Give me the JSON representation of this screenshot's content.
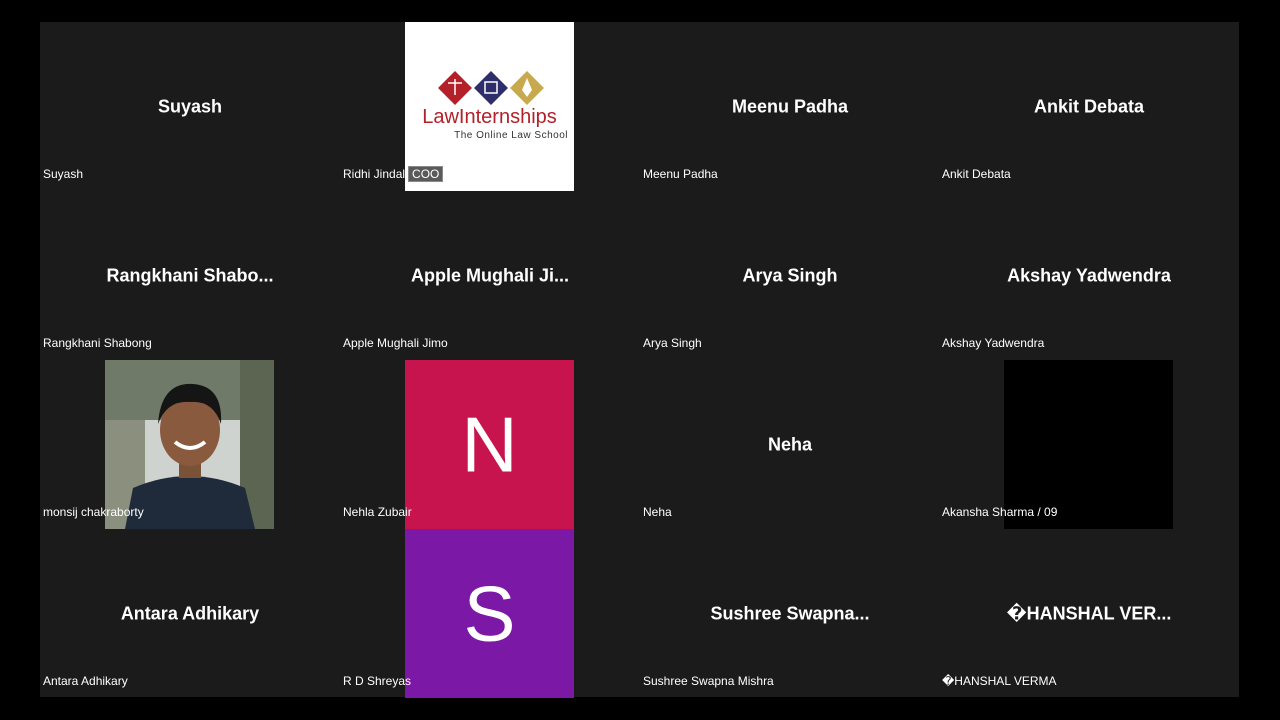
{
  "participants": [
    {
      "display": "Suyash",
      "label": "Suyash"
    },
    {
      "display": "",
      "label": "Ridhi Jindal",
      "role": "COO",
      "logo": {
        "title": "LawInternships",
        "subtitle": "The Online Law School"
      }
    },
    {
      "display": "Meenu Padha",
      "label": "Meenu Padha"
    },
    {
      "display": "Ankit Debata",
      "label": "Ankit Debata"
    },
    {
      "display": "Rangkhani  Shabo...",
      "label": "Rangkhani Shabong"
    },
    {
      "display": "Apple  Mughali  Ji...",
      "label": "Apple Mughali Jimo"
    },
    {
      "display": "Arya Singh",
      "label": "Arya Singh"
    },
    {
      "display": "Akshay Yadwendra",
      "label": "Akshay Yadwendra"
    },
    {
      "display": "",
      "label": "monsij chakraborty"
    },
    {
      "display": "",
      "label": "Nehla Zubair",
      "avatar_letter": "N",
      "avatar_color": "#c8144e"
    },
    {
      "display": "Neha",
      "label": "Neha"
    },
    {
      "display": "",
      "label": "Akansha Sharma / 09"
    },
    {
      "display": "Antara Adhikary",
      "label": "Antara Adhikary"
    },
    {
      "display": "",
      "label": "R D Shreyas",
      "avatar_letter": "S",
      "avatar_color": "#7b18a6"
    },
    {
      "display": "Sushree  Swapna...",
      "label": "Sushree Swapna Mishra"
    },
    {
      "display": "�HANSHAL  VER...",
      "label": "�HANSHAL VERMA"
    }
  ]
}
